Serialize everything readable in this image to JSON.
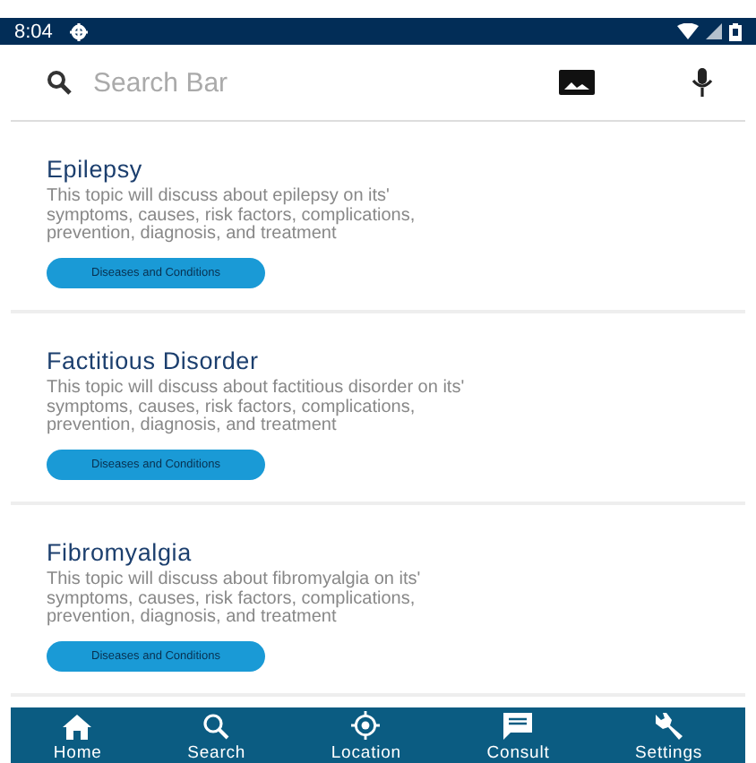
{
  "status_bar": {
    "time": "8:04"
  },
  "search": {
    "placeholder": "Search Bar"
  },
  "topics": [
    {
      "title": "Epilepsy",
      "description": "This topic will discuss about epilepsy on its' symptoms, causes, risk factors, complications, prevention, diagnosis, and treatment",
      "tag": "Diseases and Conditions"
    },
    {
      "title": "Factitious Disorder",
      "description": "This topic will discuss about factitious disorder on its' symptoms, causes, risk factors, complications, prevention, diagnosis, and treatment",
      "tag": "Diseases and Conditions"
    },
    {
      "title": "Fibromyalgia",
      "description": "This topic will discuss about fibromyalgia on its' symptoms, causes, risk factors, complications, prevention, diagnosis, and treatment",
      "tag": "Diseases and Conditions"
    }
  ],
  "bottom_nav": [
    {
      "kind": "home",
      "label": "Home"
    },
    {
      "kind": "search",
      "label": "Search"
    },
    {
      "kind": "location",
      "label": "Location"
    },
    {
      "kind": "consult",
      "label": "Consult"
    },
    {
      "kind": "settings",
      "label": "Settings"
    }
  ]
}
